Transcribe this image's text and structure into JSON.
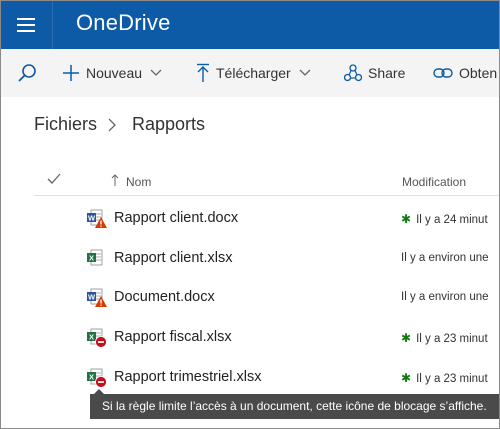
{
  "app": {
    "title": "OneDrive"
  },
  "toolbar": {
    "search_icon": "search-icon",
    "new_label": "Nouveau",
    "upload_label": "Télécharger",
    "share_label": "Share",
    "link_label": "Obten"
  },
  "breadcrumb": {
    "root": "Fichiers",
    "current": "Rapports"
  },
  "list": {
    "col_name": "Nom",
    "col_modified": "Modification",
    "rows": [
      {
        "name": "Rapport client.docx",
        "modified": "Il y a 24 minut",
        "type": "word",
        "badge": "warning",
        "star": true
      },
      {
        "name": "Rapport client.xlsx",
        "modified": "Il y a environ une",
        "type": "excel",
        "badge": "none",
        "star": false
      },
      {
        "name": "Document.docx",
        "modified": "Il y a environ une",
        "type": "word",
        "badge": "warning",
        "star": false
      },
      {
        "name": "Rapport fiscal.xlsx",
        "modified": "Il y a 23 minut",
        "type": "excel",
        "badge": "blocked",
        "star": true
      },
      {
        "name": "Rapport trimestriel.xlsx",
        "modified": "Il y a 23 minut",
        "type": "excel",
        "badge": "blocked",
        "star": true
      }
    ]
  },
  "tooltip": {
    "text": "Si la règle limite l’accès à un document, cette icône de blocage s’affiche."
  },
  "colors": {
    "suitebar": "#0d5aa7",
    "word": "#2b579a",
    "excel": "#217346",
    "warning": "#d83b01",
    "blocked": "#c50f1f",
    "new_star": "#107c10"
  }
}
